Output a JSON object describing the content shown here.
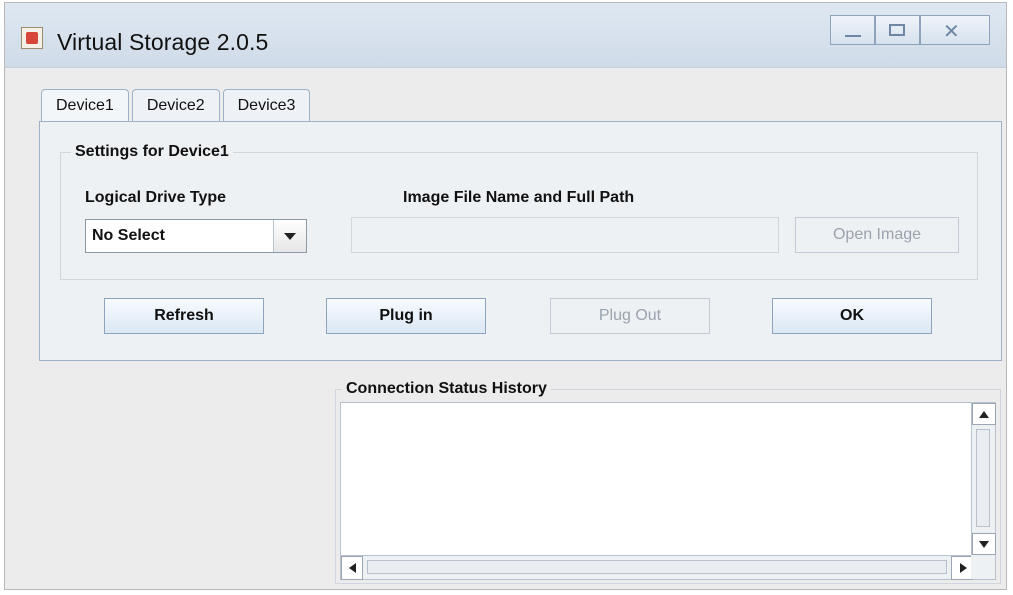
{
  "window": {
    "title": "Virtual Storage 2.0.5",
    "controls": {
      "minimize_icon": "minimize-icon",
      "maximize_icon": "maximize-icon",
      "close_icon": "close-icon"
    }
  },
  "tabs": [
    {
      "label": "Device1",
      "active": true
    },
    {
      "label": "Device2",
      "active": false
    },
    {
      "label": "Device3",
      "active": false
    }
  ],
  "settings": {
    "group_title": "Settings for Device1",
    "logical_drive_label": "Logical Drive Type",
    "logical_drive_value": "No Select",
    "image_path_label": "Image File Name and Full Path",
    "image_path_value": "",
    "open_image_label": "Open Image"
  },
  "actions": {
    "refresh": "Refresh",
    "plug_in": "Plug in",
    "plug_out": "Plug Out",
    "ok": "OK"
  },
  "status": {
    "title": "Connection Status History",
    "content": ""
  },
  "colors": {
    "button_border": "#8ea3bc",
    "disabled_text": "#9aa3ad",
    "tab_border": "#9fb1c6"
  }
}
